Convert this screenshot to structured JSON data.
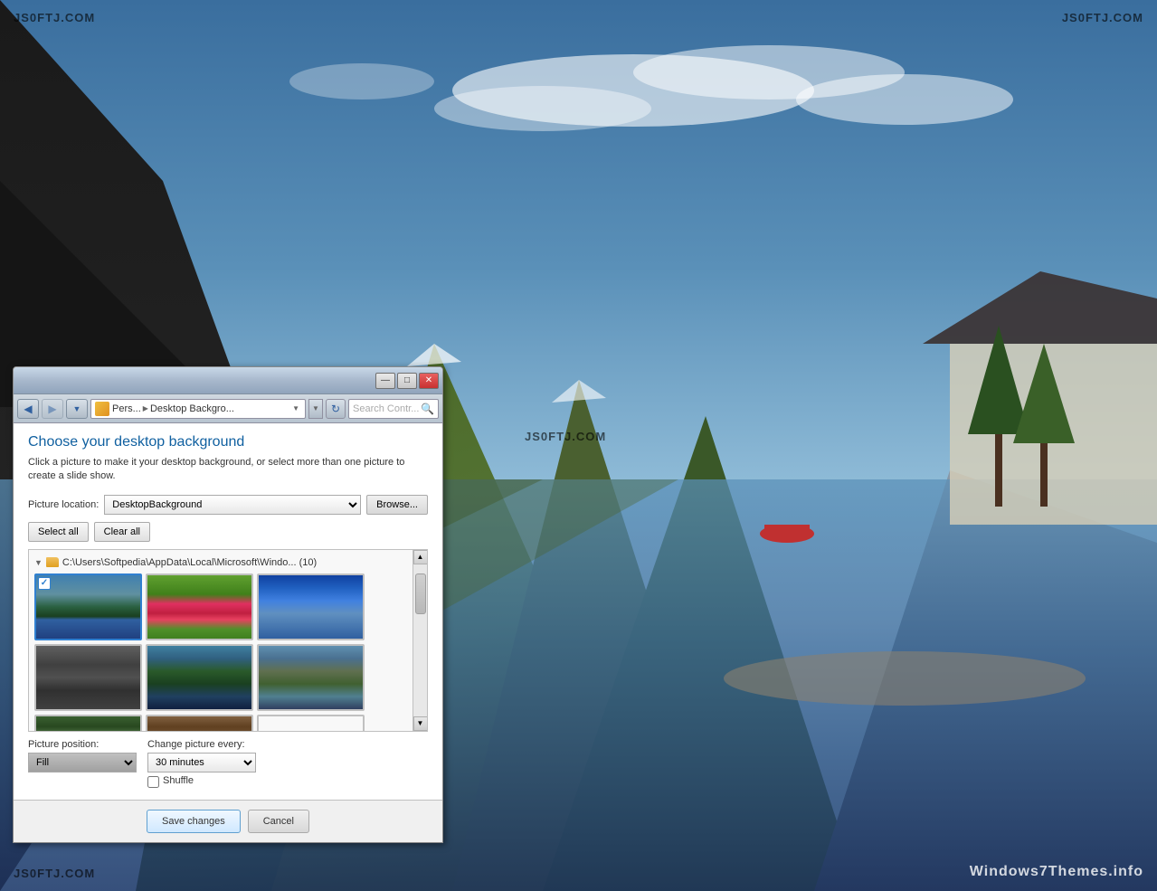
{
  "watermarks": {
    "top_left": "JS0FTJ.COM",
    "top_right": "JS0FTJ.COM",
    "center": "JS0FTJ.COM",
    "bottom_left": "JS0FTJ.COM",
    "bottom_right": "Windows7Themes.info"
  },
  "dialog": {
    "titlebar": {
      "min_label": "—",
      "max_label": "□",
      "close_label": "✕"
    },
    "addressbar": {
      "back_icon": "◀",
      "forward_icon": "▶",
      "path_part1": "Pers...",
      "path_separator": "▶",
      "path_part2": "Desktop Backgro...",
      "refresh_icon": "↻",
      "search_placeholder": "Search Contr..."
    },
    "title": "Choose your desktop background",
    "description": "Click a picture to make it your desktop background, or select more than one\npicture to create a slide show.",
    "picture_location_label": "Picture location:",
    "picture_location_value": "DesktopBackground",
    "browse_btn": "Browse...",
    "select_all_btn": "Select all",
    "clear_all_btn": "Clear all",
    "folder_path": "C:\\Users\\Softpedia\\AppData\\Local\\Microsoft\\Windo... (10)",
    "folder_arrow": "▼",
    "picture_position_label": "Picture position:",
    "change_picture_label": "Change picture every:",
    "change_picture_value": "30 minutes",
    "shuffle_label": "Shuffle",
    "save_btn": "Save changes",
    "cancel_btn": "Cancel"
  }
}
